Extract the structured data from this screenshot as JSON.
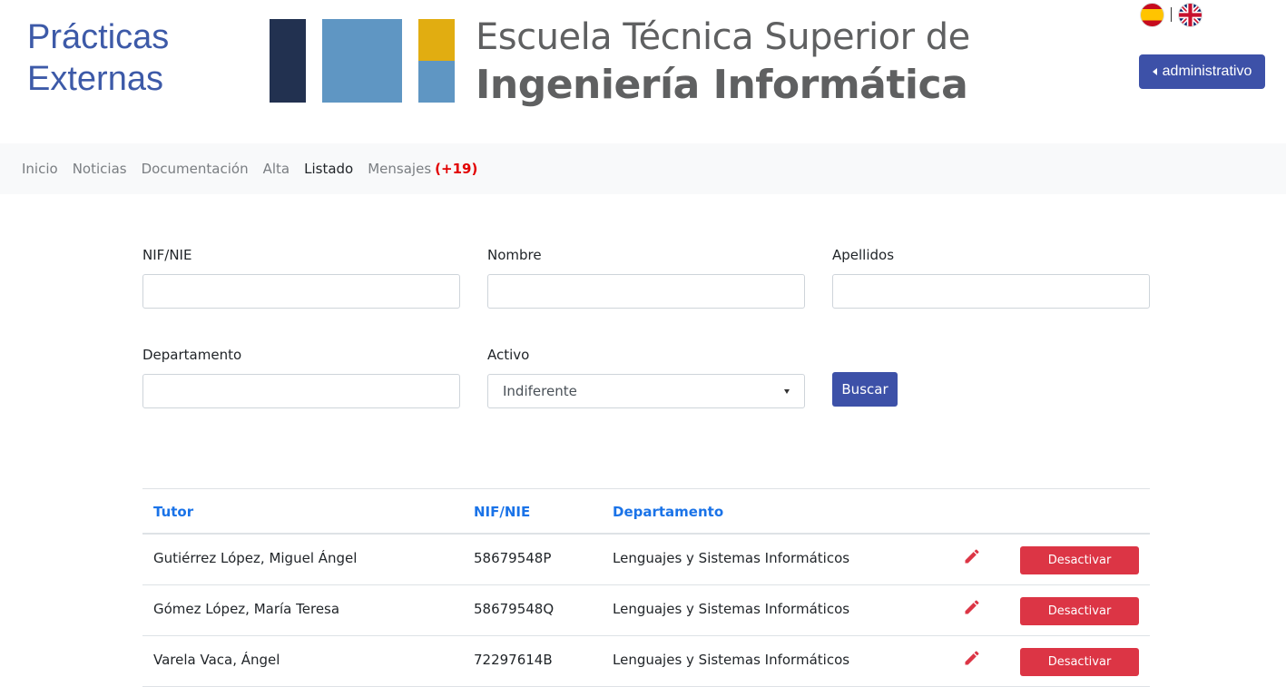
{
  "app": {
    "title_line1": "Prácticas",
    "title_line2": "Externas"
  },
  "logo": {
    "line1": "Escuela Técnica Superior de",
    "line2": "Ingeniería Informática"
  },
  "header": {
    "lang_separator": "|",
    "user_button": "administrativo"
  },
  "nav": {
    "items": [
      "Inicio",
      "Noticias",
      "Documentación",
      "Alta",
      "Listado",
      "Mensajes"
    ],
    "active": "Listado",
    "messages_badge": "(+19)"
  },
  "form": {
    "nif_label": "NIF/NIE",
    "nif_value": "",
    "nombre_label": "Nombre",
    "nombre_value": "",
    "apellidos_label": "Apellidos",
    "apellidos_value": "",
    "departamento_label": "Departamento",
    "departamento_value": "",
    "activo_label": "Activo",
    "activo_selected": "Indiferente",
    "search_button": "Buscar"
  },
  "table": {
    "headers": [
      "Tutor",
      "NIF/NIE",
      "Departamento"
    ],
    "rows": [
      {
        "tutor": "Gutiérrez López, Miguel Ángel",
        "nif": "58679548P",
        "departamento": "Lenguajes y Sistemas Informáticos",
        "action": "Desactivar"
      },
      {
        "tutor": "Gómez López, María Teresa",
        "nif": "58679548Q",
        "departamento": "Lenguajes y Sistemas Informáticos",
        "action": "Desactivar"
      },
      {
        "tutor": "Varela Vaca, Ángel",
        "nif": "72297614B",
        "departamento": "Lenguajes y Sistemas Informáticos",
        "action": "Desactivar"
      }
    ]
  },
  "colors": {
    "brand_blue": "#3d51a8",
    "title_blue": "#3d5aa8",
    "header_link": "#1a73e8",
    "danger": "#dc3545",
    "badge_red": "#e20000"
  },
  "icons": {
    "edit": "pencil-icon",
    "flag_es": "spain-flag-icon",
    "flag_en": "uk-flag-icon",
    "user_caret": "caret-left-icon",
    "select_caret": "caret-down-icon"
  }
}
